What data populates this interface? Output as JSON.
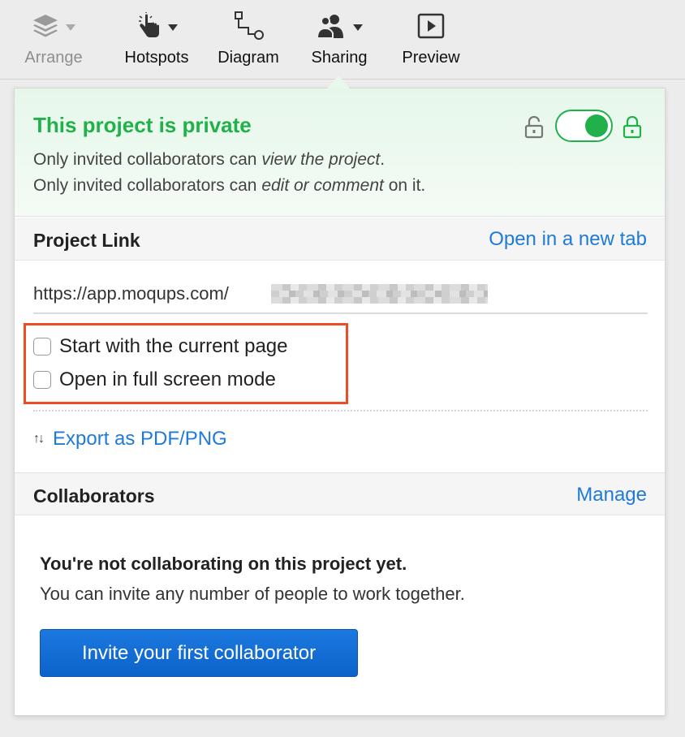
{
  "toolbar": {
    "arrange_label": "Arrange",
    "hotspots_label": "Hotspots",
    "diagram_label": "Diagram",
    "sharing_label": "Sharing",
    "preview_label": "Preview"
  },
  "privacy": {
    "title": "This project is private",
    "line1_prefix": "Only invited collaborators can ",
    "line1_emph": "view the project",
    "line1_suffix": ".",
    "line2_prefix": "Only invited collaborators can ",
    "line2_emph": "edit or comment",
    "line2_suffix": " on it.",
    "toggle_on": true
  },
  "project_link": {
    "title": "Project Link",
    "open_new_tab": "Open in a new tab",
    "url_visible": "https://app.moqups.com/"
  },
  "options": {
    "start_current_page": "Start with the current page",
    "full_screen": "Open in full screen mode"
  },
  "export": {
    "label": "Export as PDF/PNG"
  },
  "collaborators": {
    "title": "Collaborators",
    "manage": "Manage",
    "empty_title": "You're not collaborating on this project yet.",
    "empty_subtitle": "You can invite any number of people to work together.",
    "invite_button": "Invite your first collaborator"
  },
  "colors": {
    "accent_blue": "#1e7ad9",
    "success_green": "#21b14a",
    "highlight_red": "#f04b21"
  },
  "icons": [
    "layers-icon",
    "hand-pointer-icon",
    "diagram-icon",
    "users-icon",
    "play-icon",
    "unlocked-icon",
    "locked-icon",
    "sort-arrows-icon"
  ]
}
